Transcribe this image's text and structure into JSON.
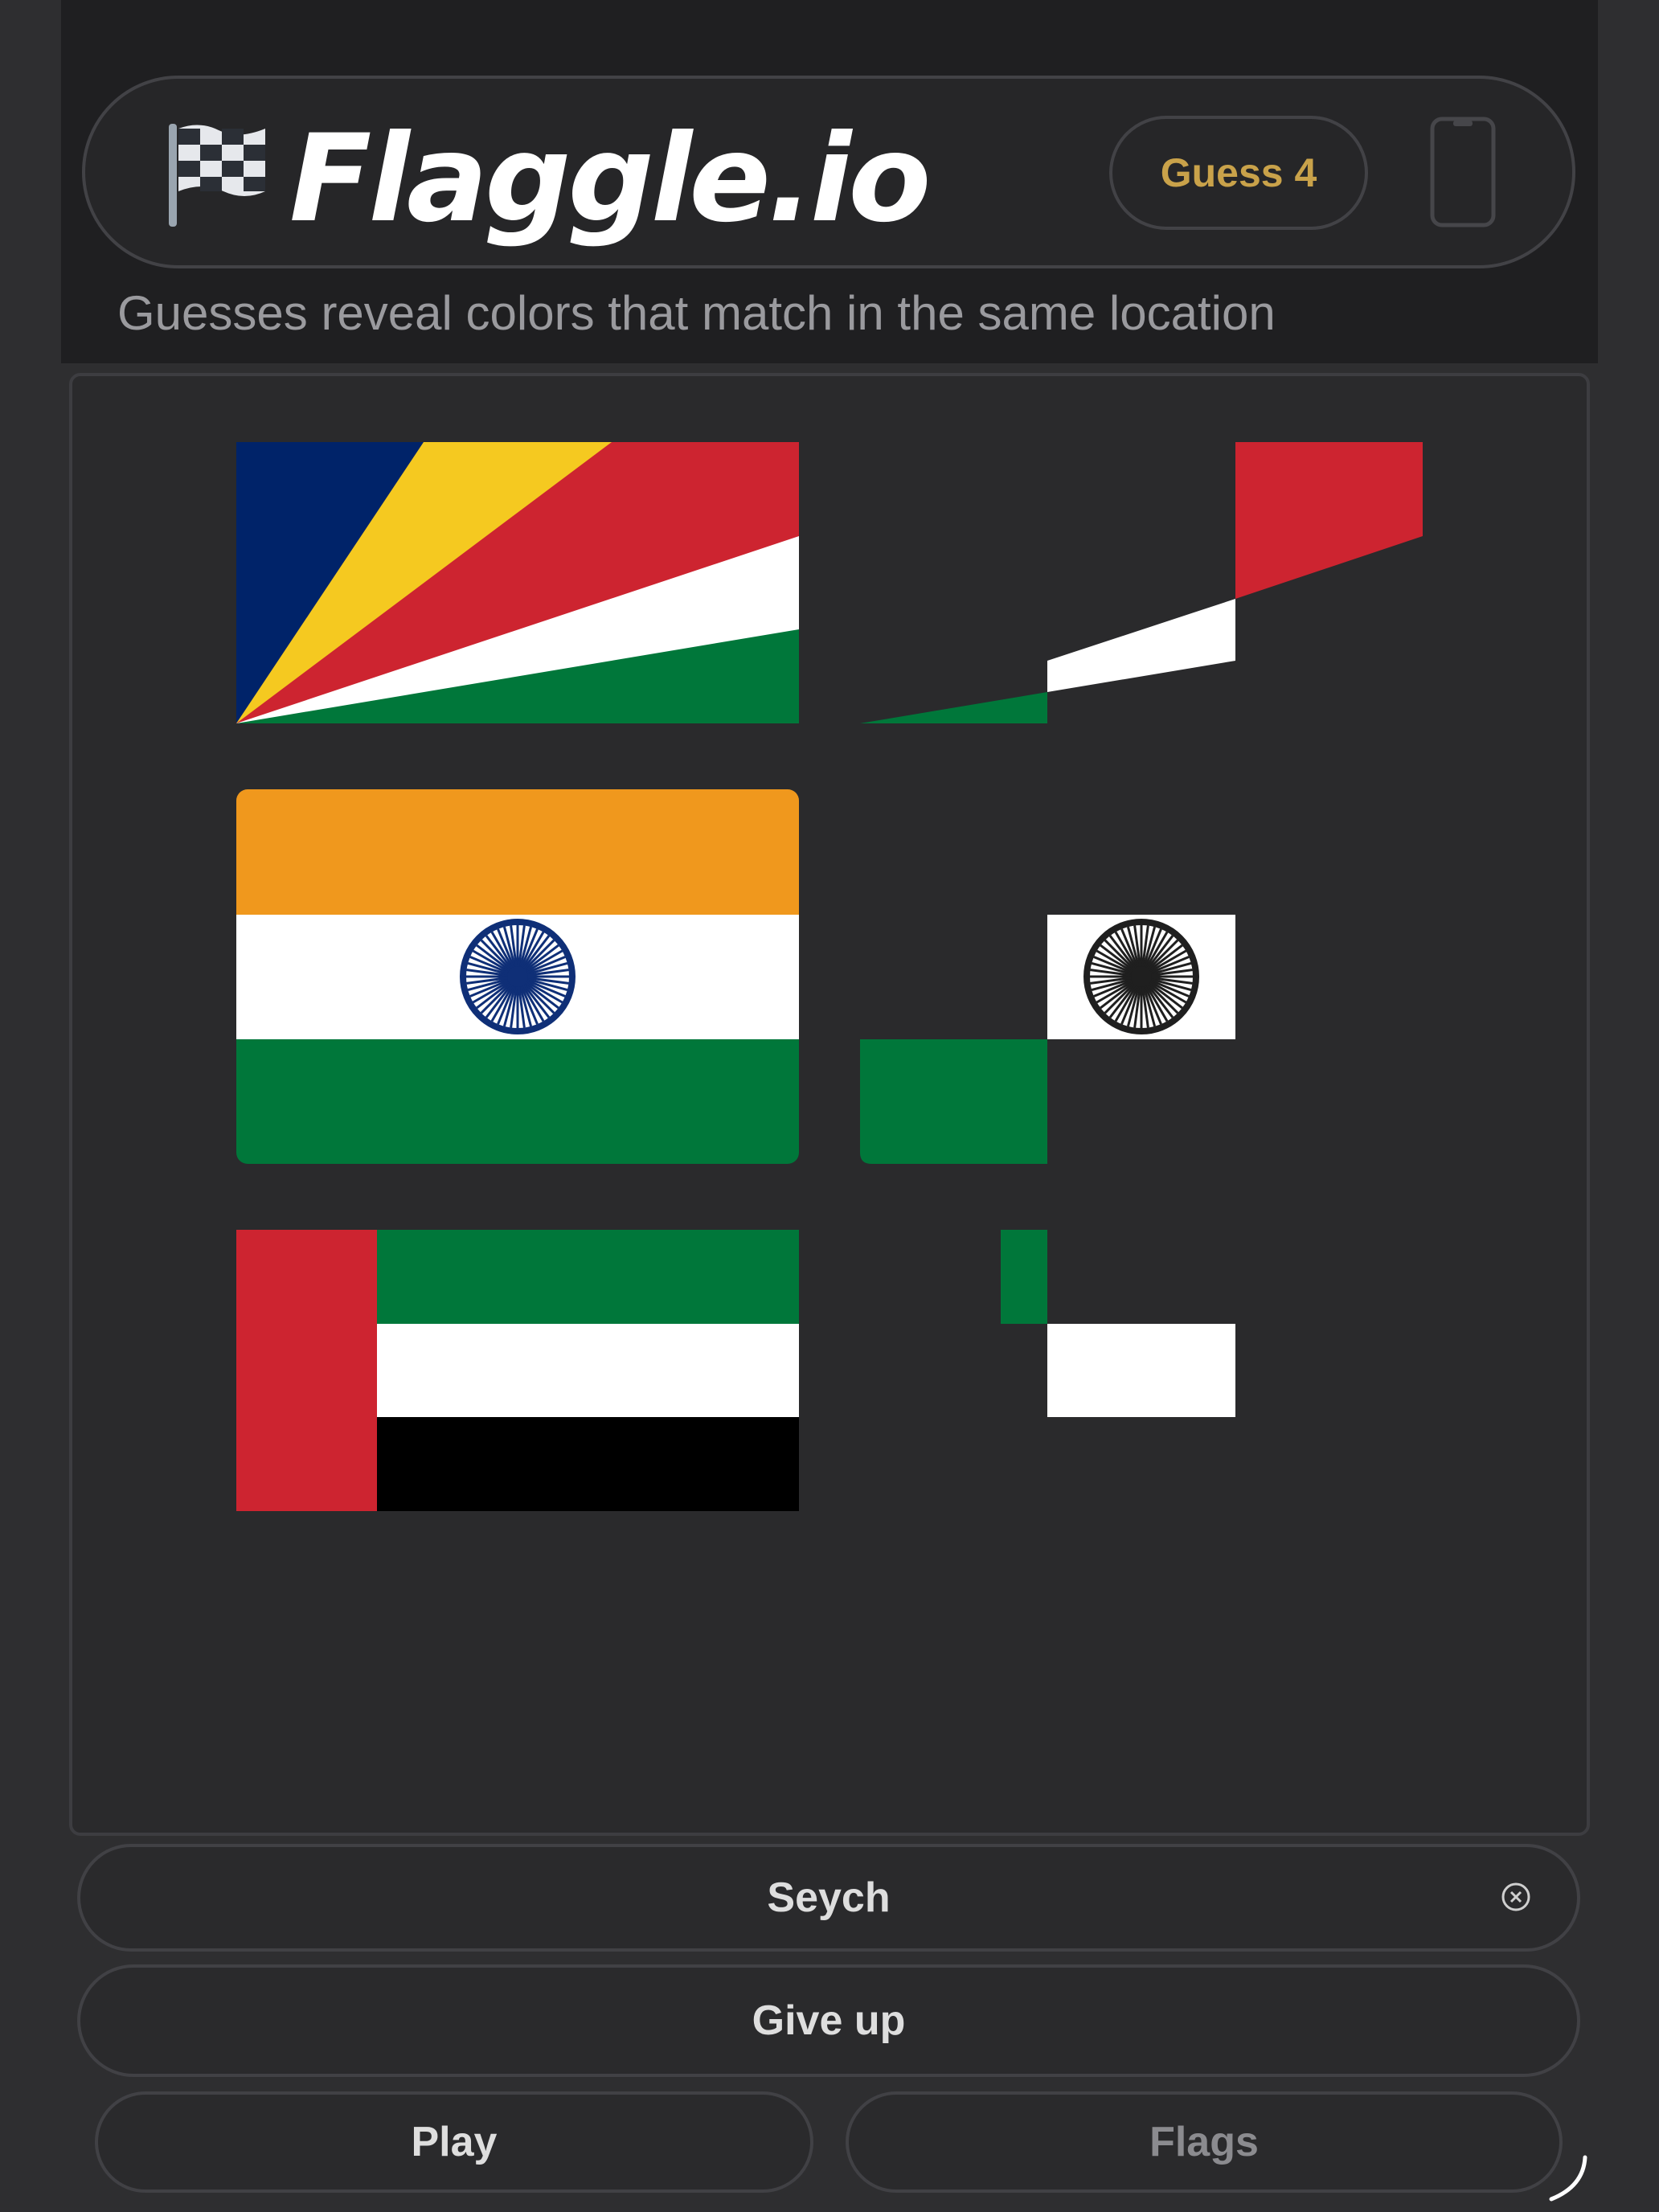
{
  "app": {
    "title": "Flaggle.io"
  },
  "header": {
    "guess_label": "Guess 4"
  },
  "subtitle": "Guesses reveal colors that match in the same location",
  "colors": {
    "background": "#2e2e30",
    "topbar": "#1f1f21",
    "accent_gold": "#c9a24a",
    "flag_red": "#cd2430",
    "flag_green": "#00773a",
    "flag_blue": "#002369",
    "flag_yellow": "#f5c920",
    "flag_saffron": "#f0981d"
  },
  "guesses": [
    {
      "country": "Seychelles",
      "revealed_colors": [
        "red",
        "white",
        "green"
      ]
    },
    {
      "country": "India",
      "revealed_colors": [
        "white",
        "chakra",
        "green"
      ]
    },
    {
      "country": "United Arab Emirates",
      "revealed_colors": [
        "green",
        "white"
      ]
    }
  ],
  "icons": {
    "logo": "checkered-flag-icon",
    "header_right": "phone-icon",
    "input_clear": "clear-circle-icon"
  },
  "input": {
    "value": "Seych"
  },
  "buttons": {
    "give_up": "Give up",
    "play": "Play",
    "flags": "Flags"
  }
}
